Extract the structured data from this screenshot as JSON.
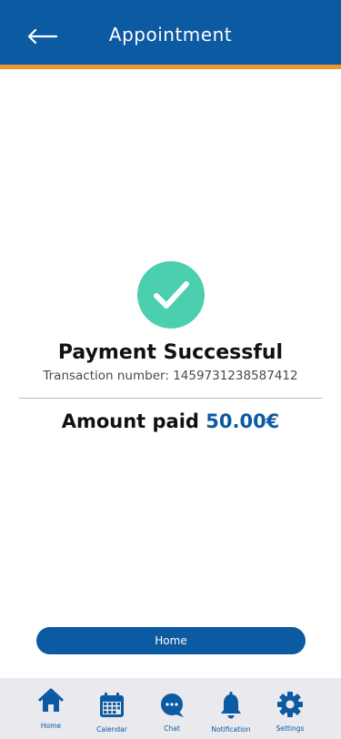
{
  "header": {
    "title": "Appointment",
    "back_icon": "arrow-left-icon"
  },
  "payment": {
    "status_icon": "check-circle-icon",
    "title": "Payment Successful",
    "transaction_label": "Transaction number:",
    "transaction_number": "1459731238587412",
    "amount_label": "Amount paid",
    "amount_value": "50.00€"
  },
  "actions": {
    "home_button": "Home"
  },
  "bottom_nav": {
    "items": [
      {
        "label": "Home",
        "icon": "home-icon"
      },
      {
        "label": "Calendar",
        "icon": "calendar-icon"
      },
      {
        "label": "Chat",
        "icon": "chat-icon"
      },
      {
        "label": "Notification",
        "icon": "bell-icon"
      },
      {
        "label": "Settings",
        "icon": "gear-icon"
      }
    ]
  },
  "colors": {
    "primary": "#0b5aa2",
    "accent": "#f0952a",
    "success": "#4bcfae",
    "nav_background": "#e9e9ee"
  }
}
